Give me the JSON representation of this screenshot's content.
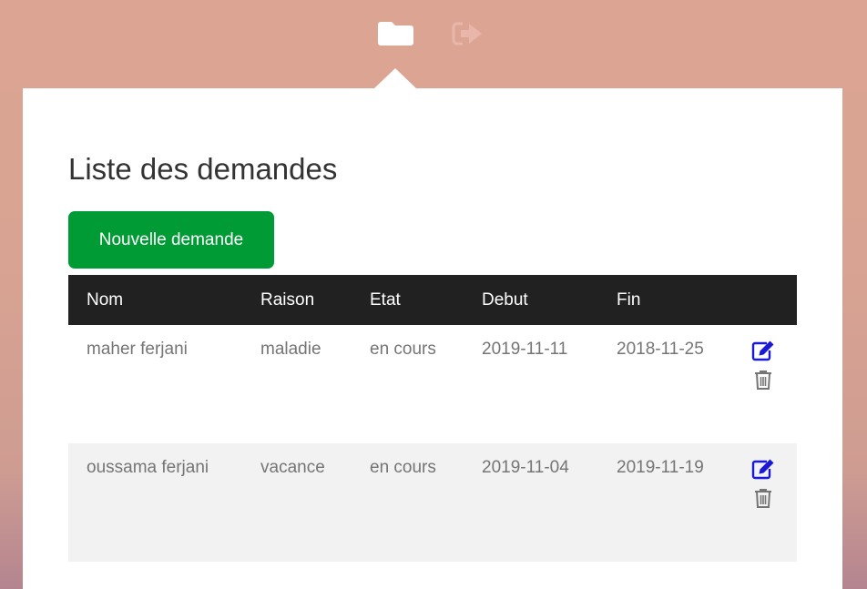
{
  "nav": {
    "folder_icon": "folder-icon",
    "logout_icon": "sign-out-icon"
  },
  "page": {
    "title": "Liste des demandes",
    "new_button_label": "Nouvelle demande"
  },
  "table": {
    "headers": [
      "Nom",
      "Raison",
      "Etat",
      "Debut",
      "Fin"
    ],
    "rows": [
      {
        "nom": "maher ferjani",
        "raison": "maladie",
        "etat": "en cours",
        "debut": "2019-11-11",
        "fin": "2018-11-25"
      },
      {
        "nom": "oussama ferjani",
        "raison": "vacance",
        "etat": "en cours",
        "debut": "2019-11-04",
        "fin": "2019-11-19"
      }
    ],
    "row_actions": [
      "edit-icon",
      "trash-icon"
    ]
  },
  "colors": {
    "accent_button": "#019b36",
    "table_header_bg": "#212121",
    "edit_icon": "#1a1ad6",
    "trash_icon": "#757575",
    "background": "#dca593"
  }
}
